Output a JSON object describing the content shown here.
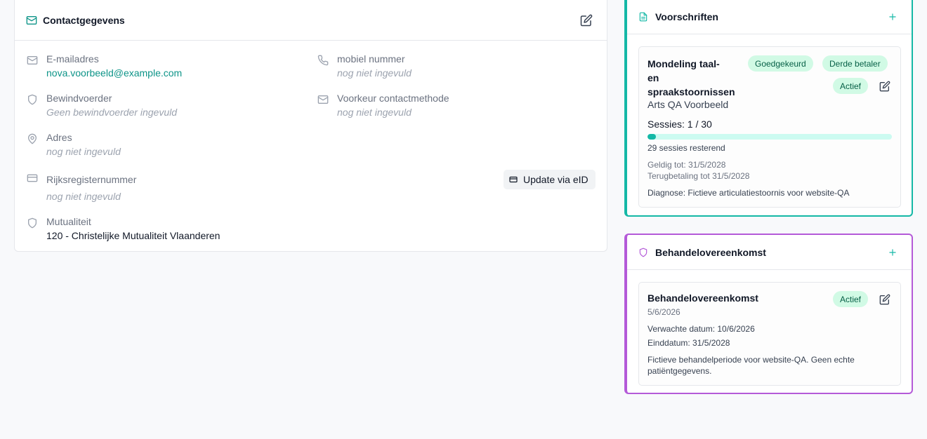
{
  "colors": {
    "accent_teal": "#14b8a6",
    "accent_purple": "#b45ad8",
    "link": "#0d9488"
  },
  "contact": {
    "title": "Contactgegevens",
    "fields": {
      "email": {
        "label": "E-mailadres",
        "value": "nova.voorbeeld@example.com",
        "icon": "mail-icon"
      },
      "mobile": {
        "label": "mobiel nummer",
        "value": "nog niet ingevuld",
        "icon": "phone-icon"
      },
      "guardian": {
        "label": "Bewindvoerder",
        "value": "Geen bewindvoerder ingevuld",
        "icon": "shield-icon"
      },
      "contact_method": {
        "label": "Voorkeur contactmethode",
        "value": "nog niet ingevuld",
        "icon": "mail-icon"
      },
      "address": {
        "label": "Adres",
        "value": "nog niet ingevuld",
        "icon": "map-pin-icon"
      },
      "national_id": {
        "label": "Rijksregisternummer",
        "value": "nog niet ingevuld",
        "icon": "id-card-icon"
      },
      "insurer": {
        "label": "Mutualiteit",
        "value": "120 - Christelijke Mutualiteit Vlaanderen",
        "icon": "shield-icon"
      }
    },
    "eid_button": "Update via eID"
  },
  "prescriptions": {
    "title": "Voorschriften",
    "item": {
      "title_lines": [
        "Mondeling taal-",
        "en",
        "spraakstoornissen"
      ],
      "doctor": "Arts QA Voorbeeld",
      "badges": [
        "Goedgekeurd",
        "Derde betaler",
        "Actief"
      ],
      "sessions_label": "Sessies: 1 / 30",
      "sessions_used": 1,
      "sessions_total": 30,
      "remaining": "29 sessies resterend",
      "valid_until": "Geldig tot: 31/5/2028",
      "refund_until": "Terugbetaling tot 31/5/2028",
      "diagnosis": "Diagnose: Fictieve articulatiestoornis voor website-QA"
    }
  },
  "agreement": {
    "title": "Behandelovereenkomst",
    "item": {
      "title": "Behandelovereenkomst",
      "date": "5/6/2026",
      "badge": "Actief",
      "expected": "Verwachte datum: 10/6/2026",
      "end": "Einddatum: 31/5/2028",
      "note_lines": [
        "Fictieve behandelperiode voor website-QA. Geen echte",
        "patiëntgegevens."
      ]
    }
  }
}
